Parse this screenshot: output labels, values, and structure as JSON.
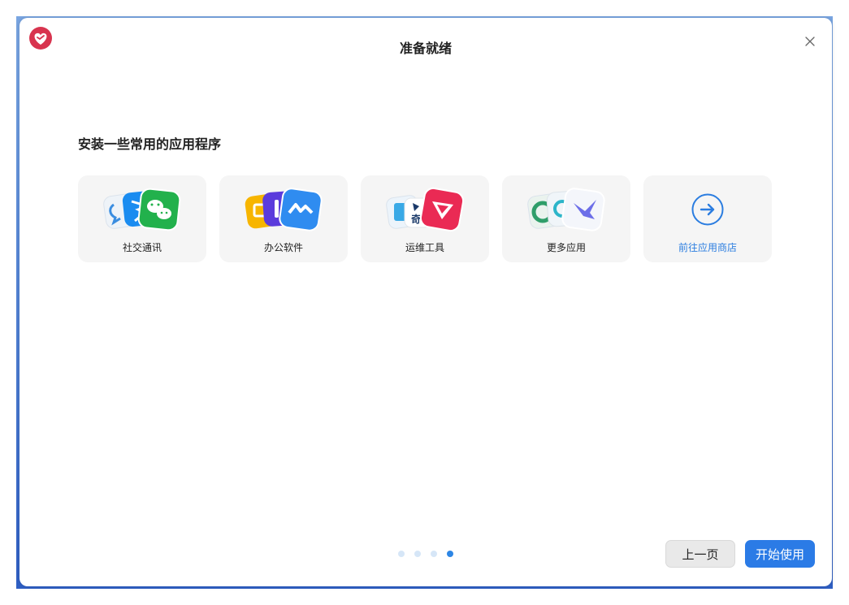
{
  "window": {
    "title": "准备就绪",
    "logo_icon": "heart-logo-icon",
    "close_icon": "close-icon"
  },
  "main": {
    "section_title": "安装一些常用的应用程序",
    "cards": [
      {
        "label": "社交通讯",
        "icons": [
          "chat-bubble-icon",
          "dingtalk-icon",
          "wechat-icon"
        ]
      },
      {
        "label": "办公软件",
        "icons": [
          "slides-icon",
          "doc-icon",
          "lark-icon"
        ]
      },
      {
        "label": "运维工具",
        "icons": [
          "file-icon",
          "qianxin-icon",
          "anydesk-icon"
        ],
        "badge_text": "奇"
      },
      {
        "label": "更多应用",
        "icons": [
          "green-app-icon",
          "colorful-app-icon",
          "bird-app-icon"
        ]
      },
      {
        "label": "前往应用商店",
        "icons": [
          "arrow-right-circle-icon"
        ],
        "is_link": true
      }
    ]
  },
  "pager": {
    "total": 4,
    "active": 4
  },
  "footer": {
    "prev_label": "上一页",
    "start_label": "开始使用"
  },
  "colors": {
    "accent": "#2b7be6",
    "link": "#2b7de0",
    "card_bg": "#f5f5f5",
    "dot_active": "#2d86e5",
    "dot_inactive": "#d6e6f7"
  }
}
